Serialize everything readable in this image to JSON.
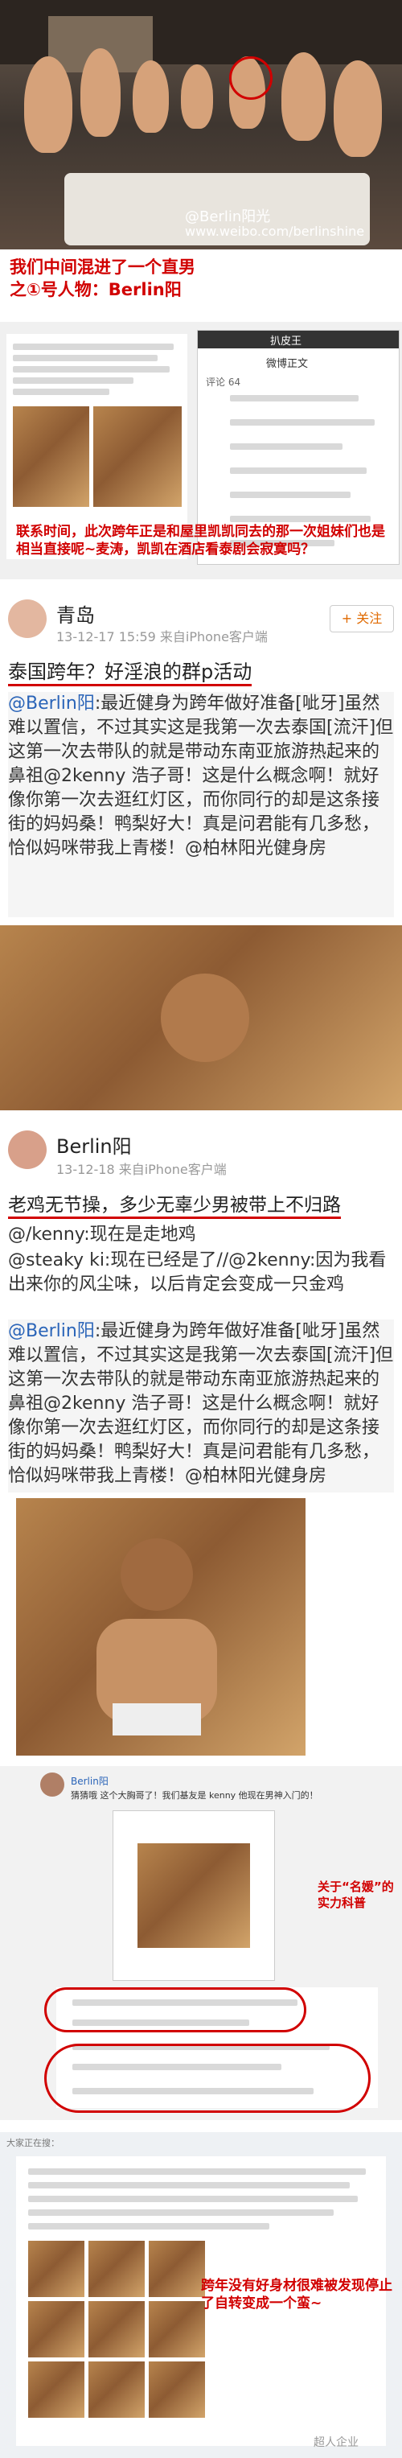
{
  "section1": {
    "watermark_name": "@Berlin阳光",
    "watermark_url": "www.weibo.com/berlinshine",
    "caption_line1": "我们中间混进了一个直男",
    "caption_line2": "之①号人物：Berlin阳"
  },
  "section2": {
    "overlay_caption": "联系时间，此次跨年正是和屋里凯凯同去的那一次姐妹们也是相当直接呢~麦涛，凯凯在酒店看泰剧会寂寞吗？",
    "screenshot_header": "扒皮王",
    "screenshot_tab": "微博正文",
    "screenshot_meta": "评论 64"
  },
  "post1": {
    "location": "青岛",
    "meta": "13-12-17 15:59  来自iPhone客户端",
    "follow_label": "+ 关注",
    "headline": "泰国跨年？好淫浪的群p活动",
    "body_prefix": "@Berlin阳",
    "body": ":最近健身为跨年做好准备[呲牙]虽然难以置信，不过其实这是我第一次去泰国[流汗]但这第一次去带队的就是带动东南亚旅游热起来的鼻祖@2kenny 浩子哥！这是什么概念啊！就好像你第一次去逛红灯区，而你同行的却是这条接街的妈妈桑！鸭梨好大！真是问君能有几多愁，恰似妈咪带我上青楼！@柏林阳光健身房"
  },
  "post2": {
    "name": "Berlin阳",
    "meta": "13-12-18  来自iPhone客户端",
    "headline": "老鸡无节操，多少无辜少男被带上不归路",
    "line2": "@/kenny:现在是走地鸡",
    "line3": "@steaky       ki:现在已经是了//@2kenny:因为我看出来你的风尘味，以后肯定会变成一只金鸡",
    "body_prefix": "@Berlin阳",
    "body": ":最近健身为跨年做好准备[呲牙]虽然难以置信，不过其实这是我第一次去泰国[流汗]但这第一次去带队的就是带动东南亚旅游热起来的鼻祖@2kenny 浩子哥！这是什么概念啊！就好像你第一次去逛红灯区，而你同行的却是这条接街的妈妈桑！鸭梨好大！真是问君能有几多愁，恰似妈咪带我上青楼！@柏林阳光健身房"
  },
  "section4": {
    "name": "Berlin阳",
    "text": "猜猜哦 这个大胸哥了！我们基友是     kenny 他现在男神入门的！",
    "annotation": "关于“名媛”的实力科普"
  },
  "section5": {
    "tab": "大家正在搜：",
    "annotation": "跨年没有好身材很难被发现停止了自转变成一个蛮~",
    "footer_logo": "超人企业"
  },
  "colors": {
    "accent_red": "#d10000",
    "link_blue": "#2a64b8",
    "emoji_yellow": "#f4c430"
  }
}
